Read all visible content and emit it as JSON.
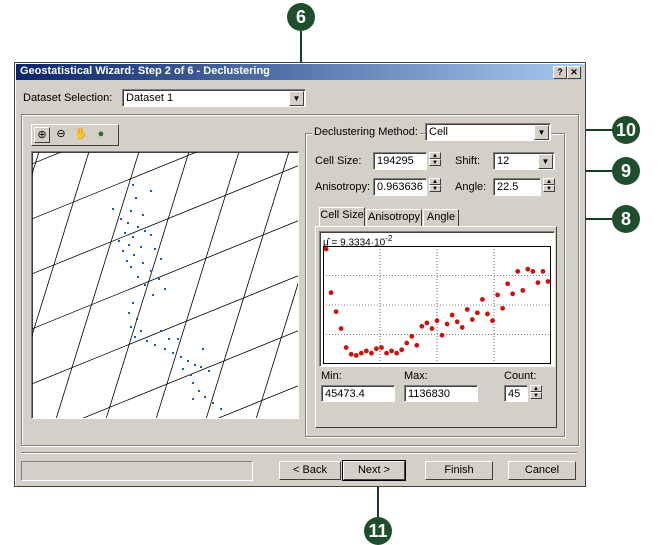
{
  "window": {
    "title": "Geostatistical Wizard: Step 2 of 6 - Declustering",
    "help_btn": "?",
    "close_btn": "✕"
  },
  "dataset": {
    "label": "Dataset Selection:",
    "value": "Dataset 1"
  },
  "map_toolbar": {
    "zoom_in": "⊕",
    "zoom_out": "⊖",
    "pan": "✋",
    "globe": "●"
  },
  "declustering": {
    "group_label": "Declustering Method:",
    "method": "Cell",
    "cell_size_label": "Cell Size:",
    "cell_size": "194295",
    "shift_label": "Shift:",
    "shift": "12",
    "anisotropy_label": "Anisotropy:",
    "anisotropy": "0.963636",
    "angle_label": "Angle:",
    "angle": "22.5"
  },
  "tabs": [
    "Cell Size",
    "Anisotropy",
    "Angle"
  ],
  "plot": {
    "formula_prefix": "μ̂ = 9.3334·10",
    "formula_exp": "-2"
  },
  "stats": {
    "min_label": "Min:",
    "min_value": "45473.4",
    "max_label": "Max:",
    "max_value": "1136830",
    "count_label": "Count:",
    "count_value": "45"
  },
  "buttons": {
    "back": "< Back",
    "next": "Next >",
    "finish": "Finish",
    "cancel": "Cancel"
  },
  "callouts": {
    "c6": "6",
    "c8": "8",
    "c9": "9",
    "c10": "10",
    "c11": "11"
  },
  "chart_data": {
    "type": "scatter",
    "title": "",
    "xlabel": "",
    "ylabel": "",
    "x": [
      0,
      1,
      2,
      3,
      4,
      5,
      6,
      7,
      8,
      9,
      10,
      11,
      12,
      13,
      14,
      15,
      16,
      17,
      18,
      19,
      20,
      21,
      22,
      23,
      24,
      25,
      26,
      27,
      28,
      29,
      30,
      31,
      32,
      33,
      34,
      35,
      36,
      37,
      38,
      39,
      40,
      41,
      42,
      43,
      44
    ],
    "y": [
      1.0,
      0.61,
      0.44,
      0.29,
      0.12,
      0.06,
      0.05,
      0.07,
      0.09,
      0.07,
      0.11,
      0.12,
      0.07,
      0.09,
      0.07,
      0.1,
      0.16,
      0.22,
      0.14,
      0.31,
      0.34,
      0.29,
      0.36,
      0.23,
      0.33,
      0.41,
      0.35,
      0.3,
      0.46,
      0.37,
      0.43,
      0.55,
      0.42,
      0.36,
      0.59,
      0.47,
      0.69,
      0.6,
      0.8,
      0.63,
      0.82,
      0.8,
      0.7,
      0.8,
      0.71
    ],
    "xlim": [
      0,
      44
    ],
    "ylim": [
      0,
      1
    ],
    "grid": true,
    "marker_color": "#cc1111"
  }
}
